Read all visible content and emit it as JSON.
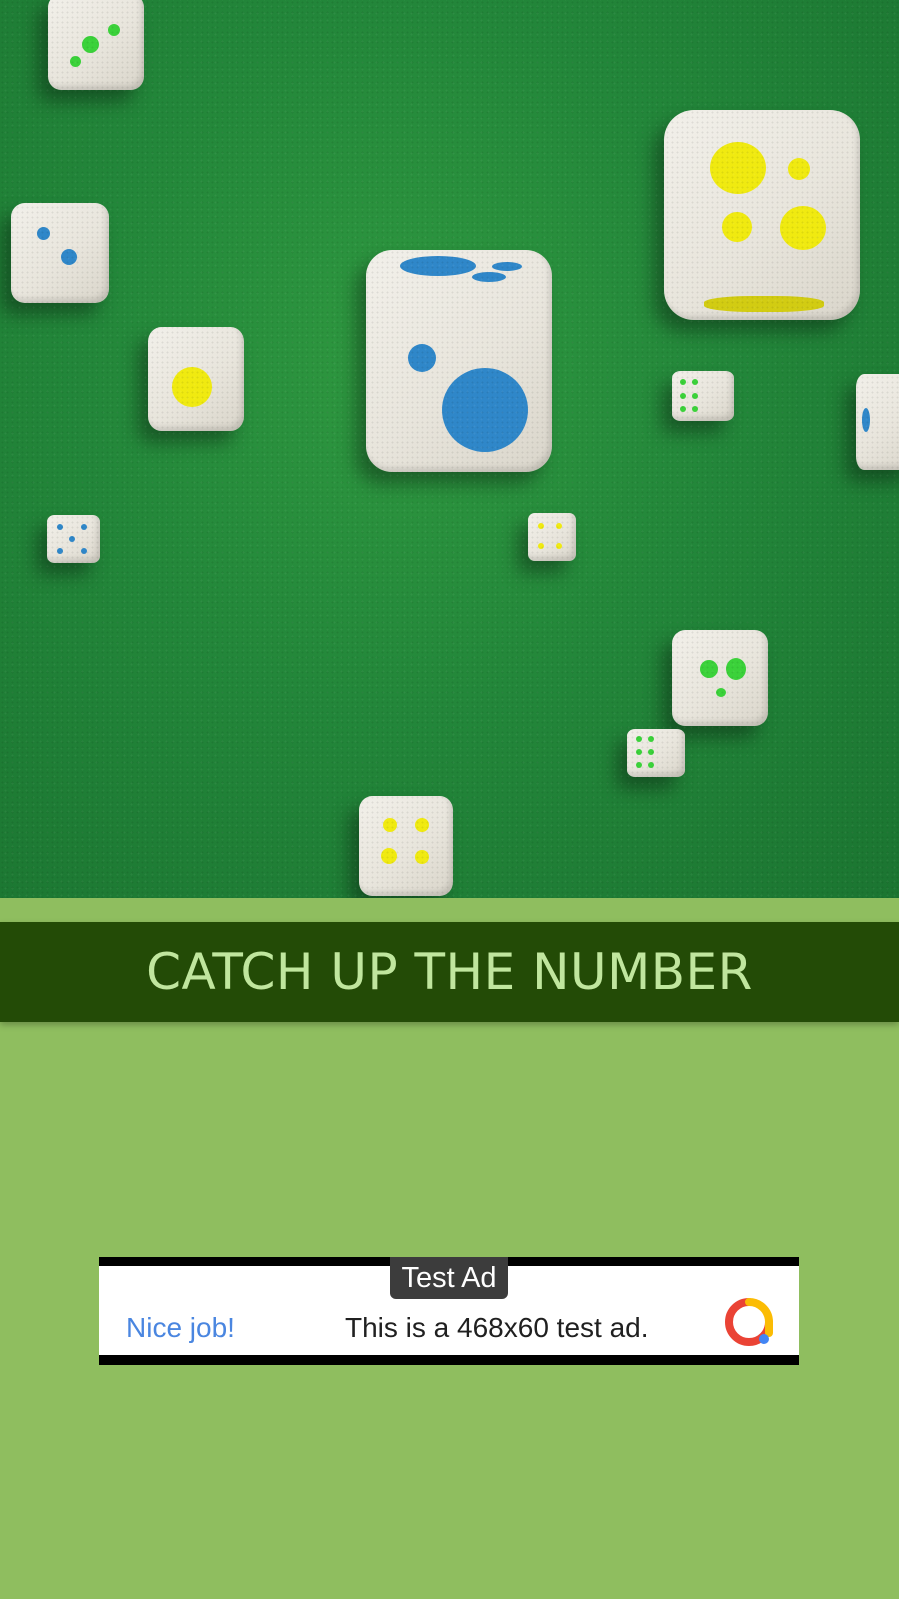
{
  "title": {
    "text": "CATCH UP THE NUMBER"
  },
  "ad": {
    "badge": "Test Ad",
    "headline": "Nice job!",
    "body": "This is a 468x60 test ad.",
    "logo_icon": "admob-logo-icon"
  },
  "colors": {
    "felt": "#23873a",
    "page_background": "#8fbe5f",
    "title_bar": "#234b06",
    "title_text": "#c0e69e",
    "pip_green": "#3bd23a",
    "pip_blue": "#2f87c9",
    "pip_yellow": "#f0ea10"
  },
  "dice": [
    {
      "name": "die-green-3-top-left",
      "pips": 3,
      "color": "green"
    },
    {
      "name": "die-blue-2-left",
      "pips": 2,
      "color": "blue"
    },
    {
      "name": "die-yellow-1",
      "pips": 1,
      "color": "yellow"
    },
    {
      "name": "die-blue-large-center",
      "pips": 2,
      "color": "blue"
    },
    {
      "name": "die-yellow-4-large-right",
      "pips": 4,
      "color": "yellow"
    },
    {
      "name": "die-green-6-small",
      "pips": 6,
      "color": "green"
    },
    {
      "name": "die-blue-edge-right",
      "pips": 1,
      "color": "blue"
    },
    {
      "name": "die-blue-5-small",
      "pips": 5,
      "color": "blue"
    },
    {
      "name": "die-yellow-small-center",
      "pips": 4,
      "color": "yellow"
    },
    {
      "name": "die-green-3-right",
      "pips": 3,
      "color": "green"
    },
    {
      "name": "die-green-6-small-bottom",
      "pips": 6,
      "color": "green"
    },
    {
      "name": "die-yellow-4-bottom",
      "pips": 4,
      "color": "yellow"
    }
  ]
}
